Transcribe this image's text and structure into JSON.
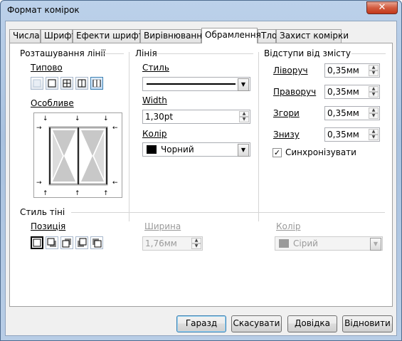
{
  "window": {
    "title": "Формат комірок",
    "close_label": "✕"
  },
  "tabs": [
    {
      "label": "Числа"
    },
    {
      "label": "Шрифт"
    },
    {
      "label": "Ефекти шрифту"
    },
    {
      "label": "Вирівнювання"
    },
    {
      "label": "Обрамлення"
    },
    {
      "label": "Тло"
    },
    {
      "label": "Захист комірки"
    }
  ],
  "line_arrangement": {
    "title": "Розташування лінії",
    "default_label": "Типово",
    "custom_label": "Особливе"
  },
  "line": {
    "title": "Лінія",
    "style_label": "Стиль",
    "width_label": "Width",
    "width_value": "1,30pt",
    "color_label": "Колір",
    "color_value": "Чорний",
    "color_hex": "#000000"
  },
  "spacing": {
    "title": "Відступи від змісту",
    "left_label": "Ліворуч",
    "left_value": "0,35мм",
    "right_label": "Праворуч",
    "right_value": "0,35мм",
    "top_label": "Згори",
    "top_value": "0,35мм",
    "bottom_label": "Знизу",
    "bottom_value": "0,35мм",
    "sync_label": "Синхронізувати",
    "sync_checked": true
  },
  "shadow": {
    "title": "Стиль тіні",
    "position_label": "Позиція",
    "width_label": "Ширина",
    "width_value": "1,76мм",
    "color_label": "Колір",
    "color_value": "Сірий",
    "color_hex": "#808080"
  },
  "buttons": {
    "ok": "Гаразд",
    "cancel": "Скасувати",
    "help": "Довідка",
    "reset": "Відновити"
  }
}
